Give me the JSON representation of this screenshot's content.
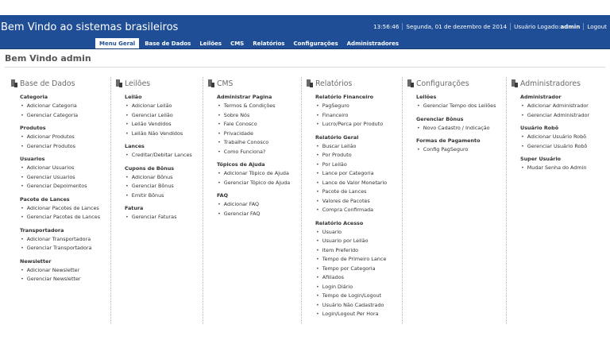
{
  "header": {
    "title": "Bem Vindo ao sistemas brasileiros",
    "time": "13:56:46",
    "date": "Segunda, 01 de dezembro de 2014",
    "logged_prefix": "Usuário Logado: ",
    "user": "admin",
    "logout": "Logout"
  },
  "tabs": [
    {
      "label": "Menu Geral"
    },
    {
      "label": "Base de Dados"
    },
    {
      "label": "Leilões"
    },
    {
      "label": "CMS"
    },
    {
      "label": "Relatórios"
    },
    {
      "label": "Configurações"
    },
    {
      "label": "Administradores"
    }
  ],
  "welcome": "Bem Vindo admin",
  "columns": [
    {
      "title": "Base de Dados",
      "groups": [
        {
          "title": "Categoria",
          "items": [
            "Adicionar Categoria",
            "Gerenciar Categoria"
          ]
        },
        {
          "title": "Produtos",
          "items": [
            "Adicionar Produtos",
            "Gerenciar Produtos"
          ]
        },
        {
          "title": "Usuarios",
          "items": [
            "Adicionar Usuarios",
            "Gerenciar Usuarios",
            "Gerenciar Depoimentos"
          ]
        },
        {
          "title": "Pacote de Lances",
          "items": [
            "Adicionar Pacotes de Lances",
            "Gerenciar Pacotes de Lances"
          ]
        },
        {
          "title": "Transportadora",
          "items": [
            "Adicionar Transportadora",
            "Gerenciar Transportadora"
          ]
        },
        {
          "title": "Newsletter",
          "items": [
            "Adicionar Newsletter",
            "Gerenciar Newsletter"
          ]
        }
      ]
    },
    {
      "title": "Leilões",
      "groups": [
        {
          "title": "Leilão",
          "items": [
            "Adicionar Leilão",
            "Gerenciar Leilão",
            "Leilão Vendidos",
            "Leilão Não Vendidos"
          ]
        },
        {
          "title": "Lances",
          "items": [
            "Creditar/Debitar Lances"
          ]
        },
        {
          "title": "Cupons de Bônus",
          "items": [
            "Adicionar Bônus",
            "Gerenciar Bônus",
            "Emitir Bônus"
          ]
        },
        {
          "title": "Fatura",
          "items": [
            "Gerenciar Faturas"
          ]
        }
      ]
    },
    {
      "title": "CMS",
      "groups": [
        {
          "title": "Administrar Pagina",
          "items": [
            "Termos & Condições",
            "Sobre Nós",
            "Fale Conosco",
            "Privacidade",
            "Trabalhe Conosco",
            "Como Funciona?"
          ]
        },
        {
          "title": "Tópicos de Ajuda",
          "items": [
            "Adicionar Tópico de Ajuda",
            "Gerenciar Tópico de Ajuda"
          ]
        },
        {
          "title": "FAQ",
          "items": [
            "Adicionar FAQ",
            "Gerenciar FAQ"
          ]
        }
      ]
    },
    {
      "title": "Relatórios",
      "groups": [
        {
          "title": "Relatório Financeiro",
          "items": [
            "PagSeguro",
            "Financeiro",
            "Lucro/Perca por Produto"
          ]
        },
        {
          "title": "Relatório Geral",
          "items": [
            "Buscar Leilão",
            "Por Produto",
            "Por Leilão",
            "Lance por Categoria",
            "Lance de Valor Monetario",
            "Pacote de Lances",
            "Valores de Pacotes",
            "Compra Confirmada"
          ]
        },
        {
          "title": "Relatório Acesso",
          "items": [
            "Usuario",
            "Usuario por Leilão",
            "Item Preferido",
            "Tempo de Primeiro Lance",
            "Tempo por Categoria",
            "Afiliados",
            "Login Diário",
            "Tempo de Login/Logout",
            "Usuário Não Cadastrado",
            "Login/Logout Per Hora"
          ]
        }
      ]
    },
    {
      "title": "Configurações",
      "groups": [
        {
          "title": "Leilões",
          "items": [
            "Gerenciar Tempo dos Leilões"
          ]
        },
        {
          "title": "Gerenciar Bônus",
          "items": [
            "Novo Cadastro / Indicação"
          ]
        },
        {
          "title": "Formas de Pagamento",
          "items": [
            "Config PagSeguro"
          ]
        }
      ]
    },
    {
      "title": "Administradores",
      "groups": [
        {
          "title": "Administrador",
          "items": [
            "Adicionar Administrador",
            "Gerenciar Administrador"
          ]
        },
        {
          "title": "Usuário Robô",
          "items": [
            "Adicionar Usuário Robô",
            "Gerenciar Usuário Robô"
          ]
        },
        {
          "title": "Super Usuário",
          "items": [
            "Mudar Senha do Admin"
          ]
        }
      ]
    }
  ]
}
